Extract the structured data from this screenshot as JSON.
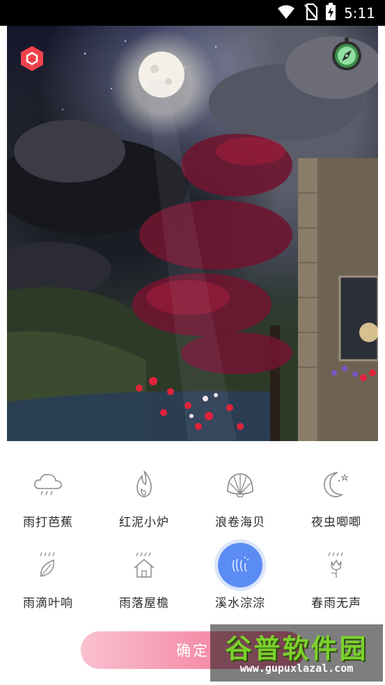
{
  "status_bar": {
    "time": "5:11",
    "icons": [
      "wifi-icon",
      "no-sim-icon",
      "battery-charging-icon"
    ]
  },
  "scene": {
    "top_left_icon": "hexagon-icon",
    "top_right_icon": "compass-icon",
    "colors": {
      "hexagon": "#f0424d",
      "compass_ring": "#3e8f4b",
      "compass_face": "#8fe0a0"
    }
  },
  "sounds": [
    {
      "label": "雨打芭蕉",
      "icon": "rain-cloud-icon",
      "selected": false
    },
    {
      "label": "红泥小炉",
      "icon": "flame-icon",
      "selected": false
    },
    {
      "label": "浪卷海贝",
      "icon": "seashell-icon",
      "selected": false
    },
    {
      "label": "夜虫唧唧",
      "icon": "crescent-moon-icon",
      "selected": false
    },
    {
      "label": "雨滴叶响",
      "icon": "rain-leaf-icon",
      "selected": false
    },
    {
      "label": "雨落屋檐",
      "icon": "rain-house-icon",
      "selected": false
    },
    {
      "label": "溪水淙淙",
      "icon": "stream-icon",
      "selected": true
    },
    {
      "label": "春雨无声",
      "icon": "rain-flower-icon",
      "selected": false
    }
  ],
  "confirm": {
    "label": "确定"
  },
  "watermark": {
    "title": "谷普软件园",
    "url": "www.gupuxlazal.com"
  },
  "colors": {
    "selected": "#5b8cf4",
    "confirm_start": "#f8c1d0",
    "confirm_end": "#f27897",
    "icon_stroke": "#8a8a8a"
  }
}
